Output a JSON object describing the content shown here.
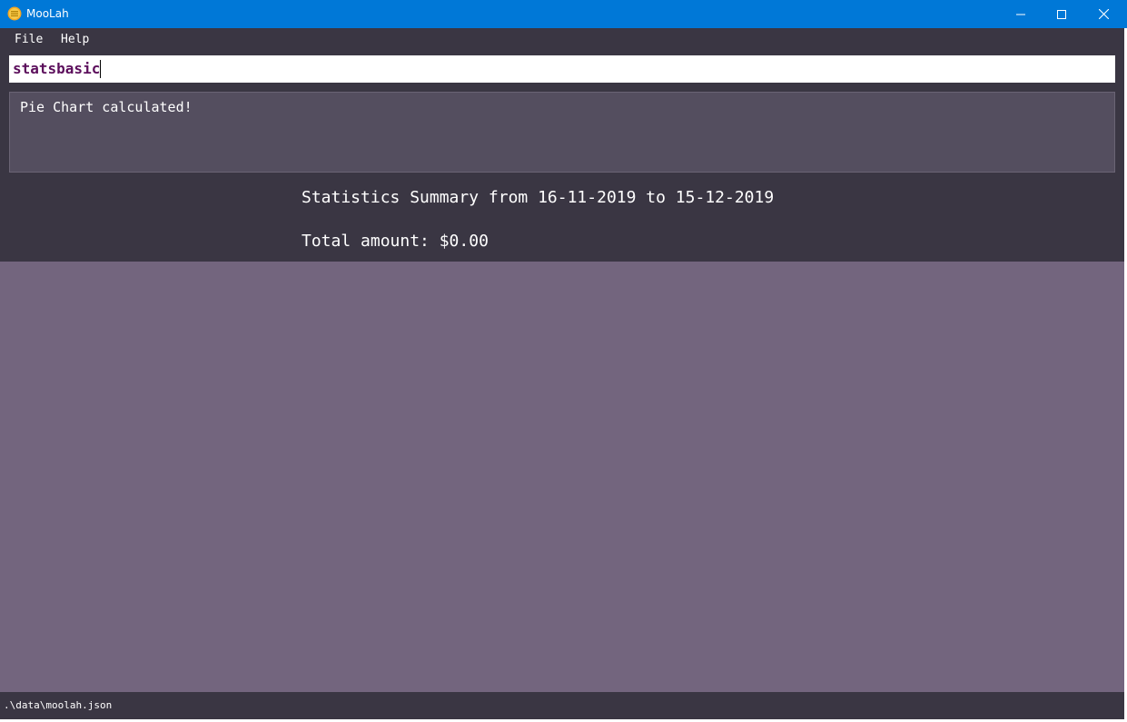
{
  "window": {
    "title": "MooLah",
    "icon": "moolah-app-icon",
    "controls": [
      "minimize-icon",
      "maximize-icon",
      "close-icon"
    ],
    "titlebar_color": "#0078d7"
  },
  "menu": {
    "file": "File",
    "help": "Help"
  },
  "command_box": {
    "value": "statsbasic"
  },
  "result_display": {
    "text": "Pie Chart calculated!"
  },
  "stats": {
    "title": "Statistics Summary from 16-11-2019 to 15-12-2019",
    "total": "Total amount: $0.00"
  },
  "status_bar": {
    "path": ".\\data\\moolah.json"
  },
  "colors": {
    "background": "#3a3643",
    "chart_area": "#73657e",
    "result_box": "#544e5f",
    "command_text": "#5c0f5c"
  }
}
